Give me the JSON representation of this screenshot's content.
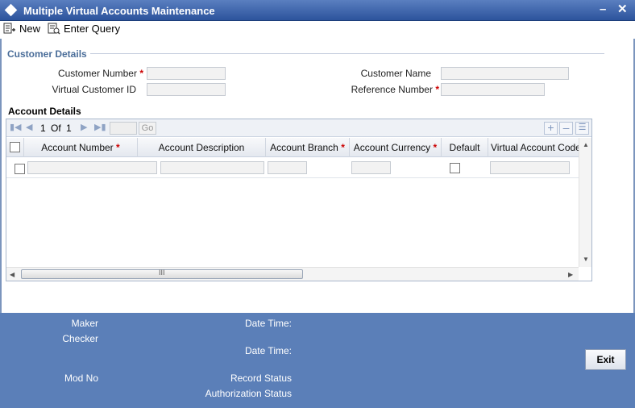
{
  "window": {
    "title": "Multiple Virtual Accounts Maintenance",
    "minimize_glyph": "–",
    "close_glyph": "✕"
  },
  "toolbar": {
    "new_label": "New",
    "new_icon": "new-document-icon",
    "enter_query_label": "Enter Query",
    "enter_query_icon": "query-icon"
  },
  "customer_details": {
    "section_title": "Customer Details",
    "customer_number_label": "Customer Number",
    "customer_number_value": "",
    "customer_name_label": "Customer Name",
    "customer_name_value": "",
    "virtual_customer_id_label": "Virtual Customer ID",
    "virtual_customer_id_value": "",
    "reference_number_label": "Reference Number",
    "reference_number_value": "",
    "required_mark": "*"
  },
  "account_details": {
    "section_title": "Account Details",
    "pagination": {
      "current": "1",
      "of_label": "Of",
      "total": "1",
      "page_input": "",
      "go_label": "Go"
    },
    "columns": [
      {
        "label": "Account Number",
        "required": "*"
      },
      {
        "label": "Account Description",
        "required": ""
      },
      {
        "label": "Account Branch",
        "required": "*"
      },
      {
        "label": "Account Currency",
        "required": "*"
      },
      {
        "label": "Default",
        "required": ""
      },
      {
        "label": "Virtual Account Code",
        "required": ""
      }
    ],
    "rows": [
      {
        "account_number": "",
        "account_description": "",
        "account_branch": "",
        "account_currency": "",
        "default": false,
        "virtual_account_code": ""
      }
    ],
    "scrollbar_grip": "III"
  },
  "footer": {
    "maker_label": "Maker",
    "checker_label": "Checker",
    "date_time_label_1": "Date Time:",
    "date_time_label_2": "Date Time:",
    "mod_no_label": "Mod No",
    "record_status_label": "Record Status",
    "authorization_status_label": "Authorization Status",
    "exit_label": "Exit"
  },
  "colors": {
    "title_bar": "#2c539c",
    "footer": "#5b7fb8",
    "section_title": "#4a6d99",
    "required": "#cc0000"
  }
}
